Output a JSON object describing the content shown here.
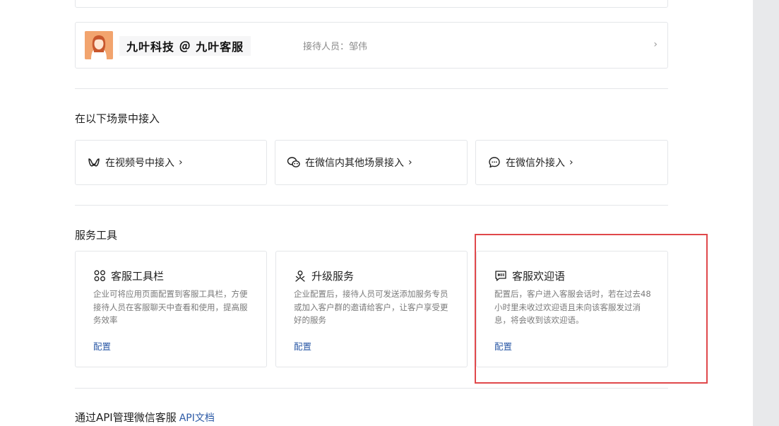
{
  "account": {
    "name": "九叶科技 ＠ 九叶客服",
    "staff": "接待人员：邹伟"
  },
  "scenes": {
    "title": "在以下场景中接入",
    "items": [
      {
        "label": "在视频号中接入",
        "icon": "channels-icon"
      },
      {
        "label": "在微信内其他场景接入",
        "icon": "wechat-chat-icon"
      },
      {
        "label": "在微信外接入",
        "icon": "message-bubble-icon"
      }
    ]
  },
  "tools": {
    "title": "服务工具",
    "items": [
      {
        "title": "客服工具栏",
        "desc": "企业可将应用页面配置到客服工具栏，方便接待人员在客服聊天中查看和使用，提高服务效率",
        "link": "配置",
        "icon": "toolbar-grid-icon"
      },
      {
        "title": "升级服务",
        "desc": "企业配置后，接待人员可发送添加服务专员或加入客户群的邀请给客户，让客户享受更好的服务",
        "link": "配置",
        "icon": "upgrade-service-icon"
      },
      {
        "title": "客服欢迎语",
        "desc": "配置后，客户进入客服会话时，若在过去48小时里未收过欢迎语且未向该客服发过消息，将会收到该欢迎语。",
        "link": "配置",
        "icon": "welcome-message-icon"
      }
    ]
  },
  "api": {
    "text": "通过API管理微信客服",
    "link": "API文档"
  },
  "colors": {
    "link": "#2c5aa6",
    "highlight": "#e0484b",
    "border": "#e4e6e9"
  }
}
